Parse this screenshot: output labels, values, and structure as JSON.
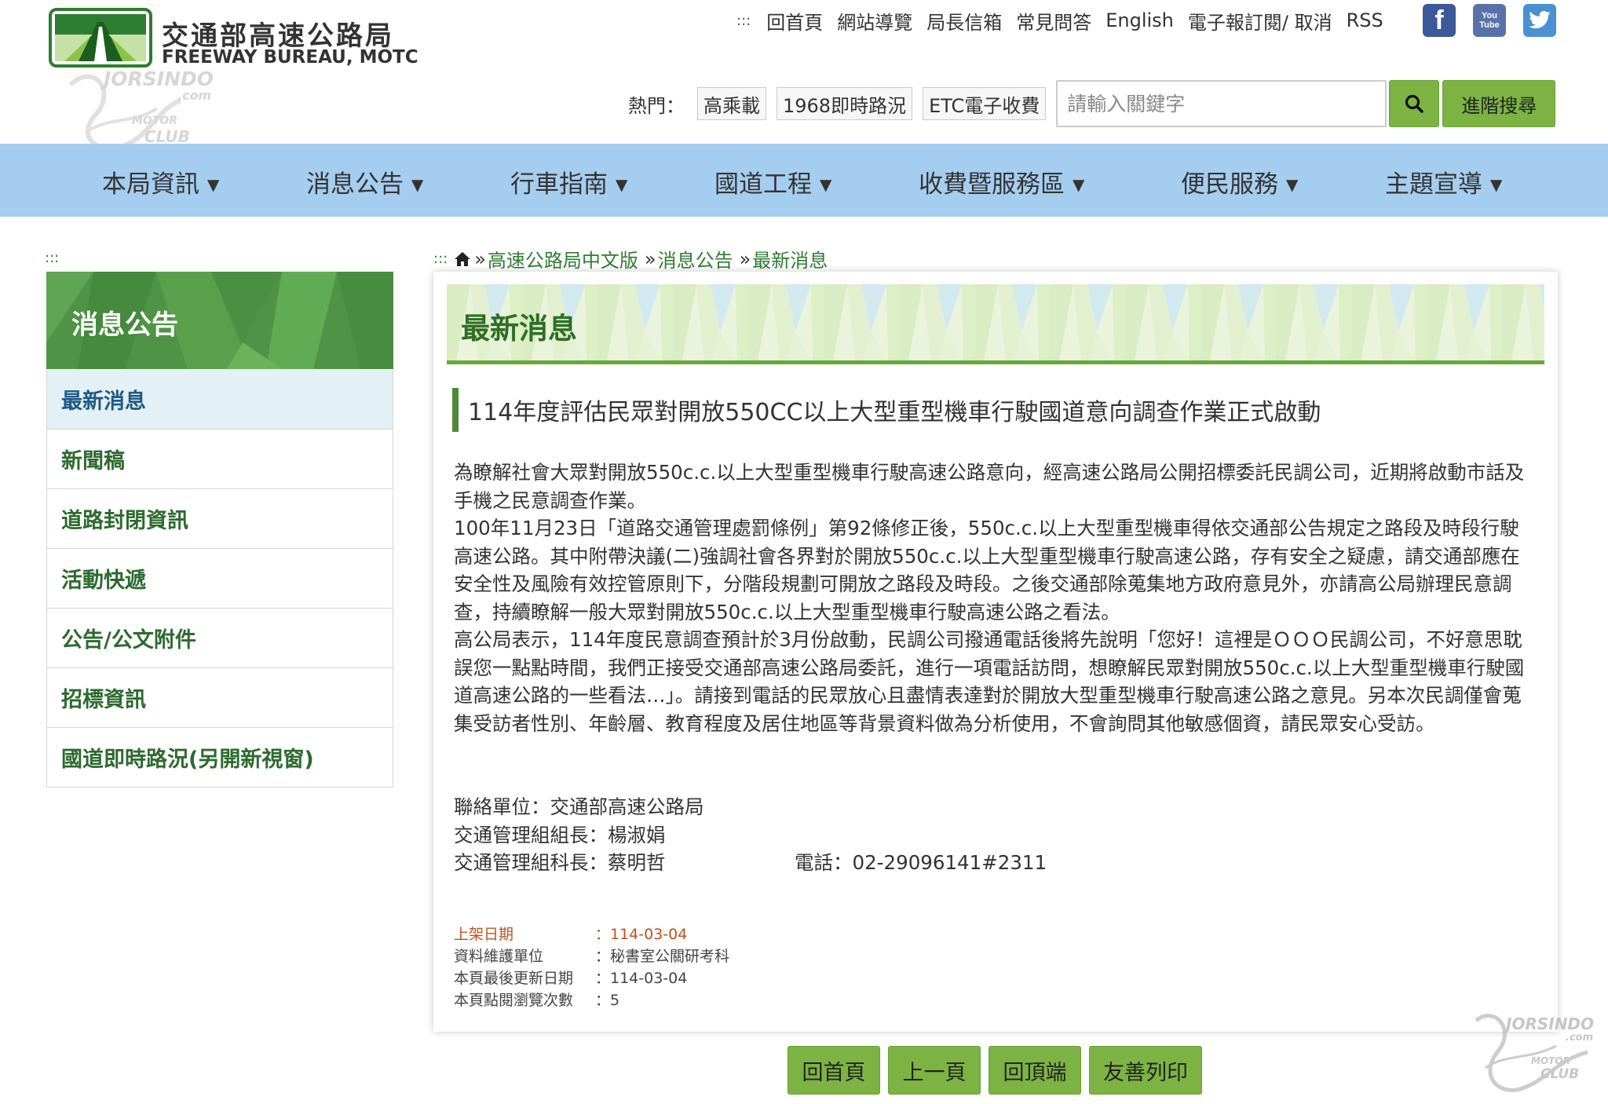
{
  "header": {
    "logo_zh": "交通部高速公路局",
    "logo_en": "FREEWAY BUREAU, MOTC",
    "access_key": ":::",
    "top_links": [
      "回首頁",
      "網站導覽",
      "局長信箱",
      "常見問答",
      "English",
      "電子報訂閱/ 取消",
      "RSS"
    ],
    "social": [
      {
        "name": "facebook",
        "glyph": "f",
        "color": "#3b5998"
      },
      {
        "name": "youtube",
        "glyph": "You Tube",
        "color": "#5872a9"
      },
      {
        "name": "twitter",
        "glyph": "t",
        "color": "#4b90d1"
      }
    ]
  },
  "search": {
    "hot_label": "熱門：",
    "hot_tags": [
      "高乘載",
      "1968即時路況",
      "ETC電子收費"
    ],
    "placeholder": "請輸入關鍵字",
    "advanced_label": "進階搜尋"
  },
  "nav": [
    "本局資訊",
    "消息公告",
    "行車指南",
    "國道工程",
    "收費暨服務區",
    "便民服務",
    "主題宣導"
  ],
  "sidebar": {
    "access_key": ":::",
    "title": "消息公告",
    "items": [
      "最新消息",
      "新聞稿",
      "道路封閉資訊",
      "活動快遞",
      "公告/公文附件",
      "招標資訊",
      "國道即時路況(另開新視窗)"
    ]
  },
  "breadcrumb": {
    "access_key": ":::",
    "items": [
      "高速公路局中文版",
      "消息公告",
      "最新消息"
    ]
  },
  "content": {
    "section_title": "最新消息",
    "article_title": "114年度評估民眾對開放550CC以上大型重型機車行駛國道意向調查作業正式啟動",
    "paragraphs": [
      "為瞭解社會大眾對開放550c.c.以上大型重型機車行駛高速公路意向，經高速公路局公開招標委託民調公司，近期將啟動市話及手機之民意調查作業。",
      "100年11月23日「道路交通管理處罰條例」第92條修正後，550c.c.以上大型重型機車得依交通部公告規定之路段及時段行駛高速公路。其中附帶決議(二)強調社會各界對於開放550c.c.以上大型重型機車行駛高速公路，存有安全之疑慮，請交通部應在安全性及風險有效控管原則下，分階段規劃可開放之路段及時段。之後交通部除蒐集地方政府意見外，亦請高公局辦理民意調查，持續瞭解一般大眾對開放550c.c.以上大型重型機車行駛高速公路之看法。",
      "高公局表示，114年度民意調查預計於3月份啟動，民調公司撥通電話後將先說明「您好！這裡是ＯＯＯ民調公司，不好意思耽誤您一點點時間，我們正接受交通部高速公路局委託，進行一項電話訪問，想瞭解民眾對開放550c.c.以上大型重型機車行駛國道高速公路的一些看法…」。請接到電話的民眾放心且盡情表達對於開放大型重型機車行駛高速公路之意見。另本次民調僅會蒐集受訪者性別、年齡層、教育程度及居住地區等背景資料做為分析使用，不會詢問其他敏感個資，請民眾安心受訪。"
    ],
    "contact": {
      "unit": "聯絡單位：交通部高速公路局",
      "leader": "交通管理組組長：楊淑娟",
      "chief": "交通管理組科長：蔡明哲",
      "phone": "電話：02-29096141#2311"
    },
    "meta": [
      {
        "key": "上架日期",
        "value": "：114-03-04"
      },
      {
        "key": "資料維護單位",
        "value": "：秘書室公關研考科"
      },
      {
        "key": "本頁最後更新日期",
        "value": "：114-03-04"
      },
      {
        "key": "本頁點閱瀏覽次數",
        "value": "：5"
      }
    ]
  },
  "bottom_buttons": [
    "回首頁",
    "上一頁",
    "回頂端",
    "友善列印"
  ],
  "watermark": {
    "line1": "JORSINDO",
    "line2": ".com",
    "line3": "MOTOR",
    "line4": "CLUB"
  },
  "colors": {
    "accent_green": "#7cb342",
    "nav_blue": "#a5cdef",
    "sidebar_green": "#4f9446",
    "date_orange": "#c0521e"
  }
}
